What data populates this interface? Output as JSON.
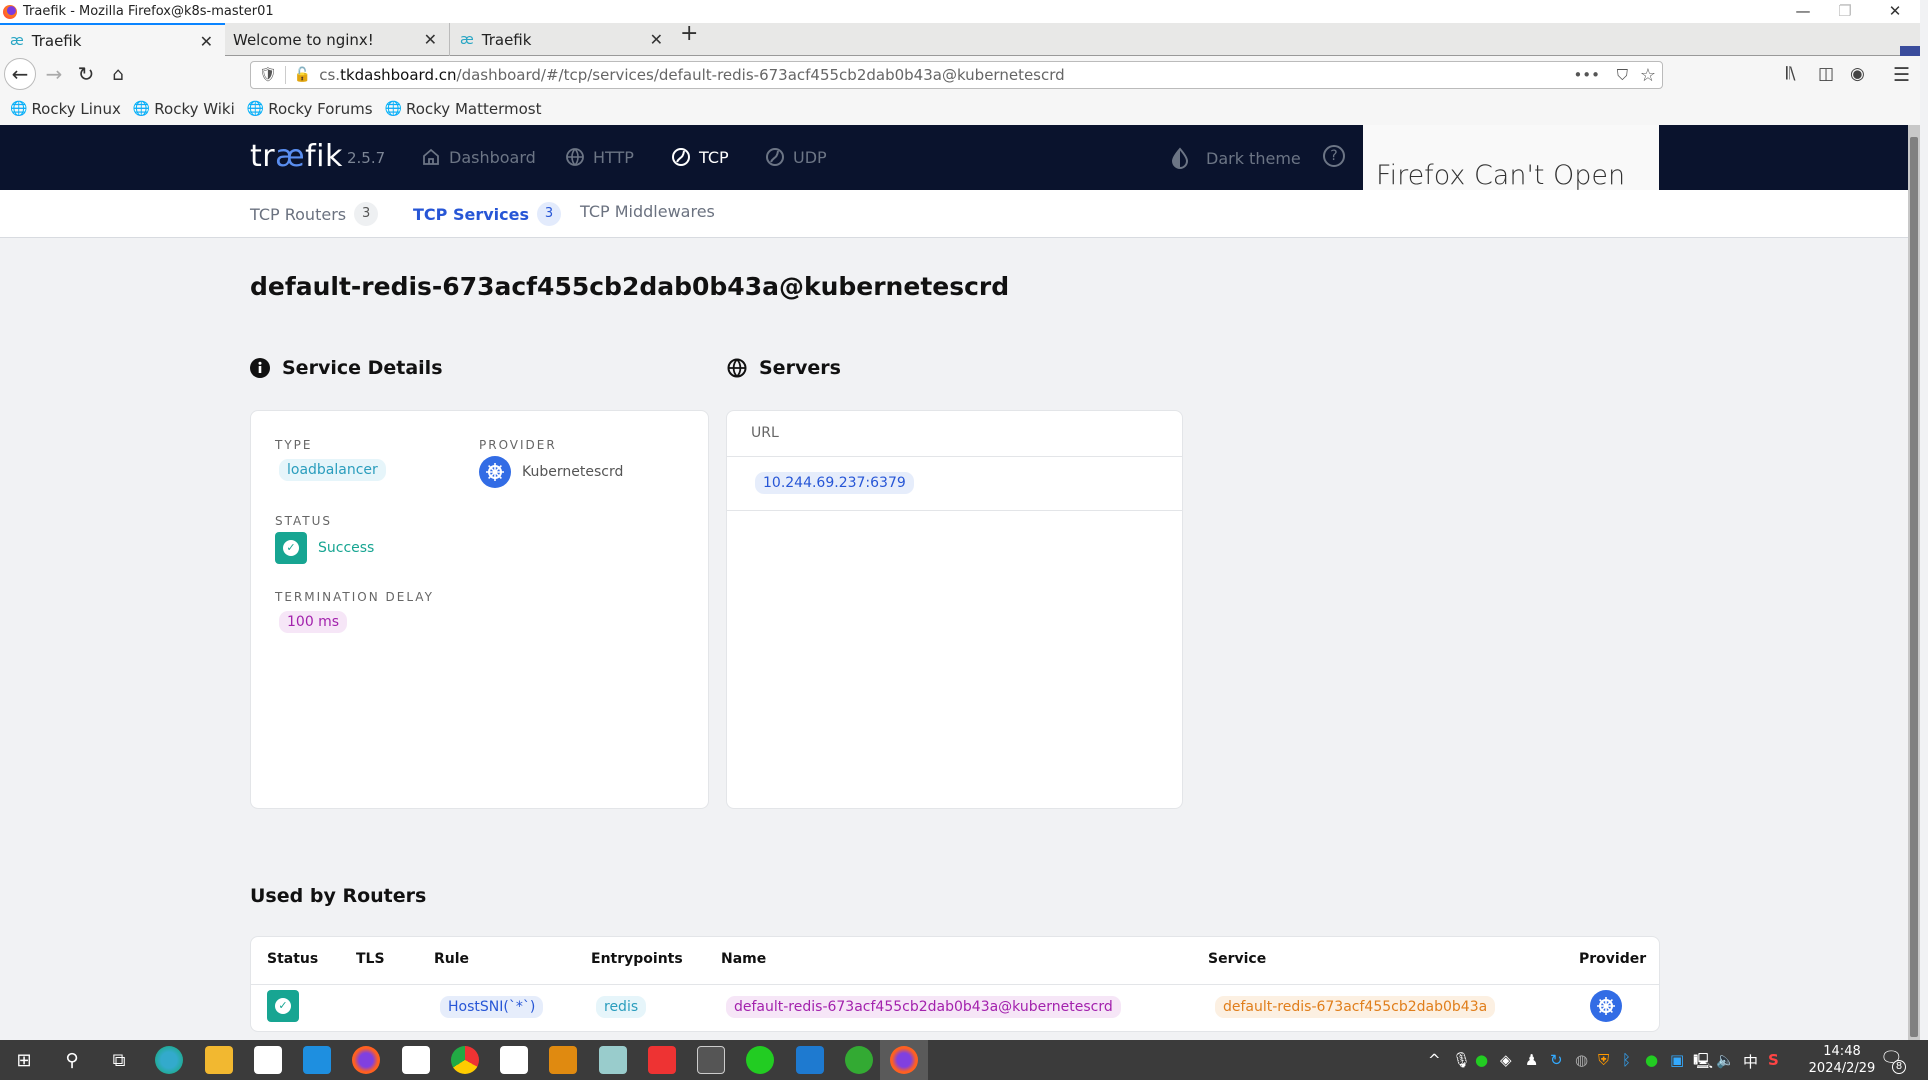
{
  "window": {
    "title": "Traefik - Mozilla Firefox@k8s-master01",
    "controls": {
      "minimize": "—",
      "maximize": "❐",
      "close": "✕"
    }
  },
  "tabs": [
    {
      "label": "Traefik",
      "icon": "ae-icon",
      "active": true
    },
    {
      "label": "Welcome to nginx!",
      "icon": "",
      "active": false
    },
    {
      "label": "Traefik",
      "icon": "ae-icon",
      "active": false
    }
  ],
  "navbar": {
    "url_prefix": "cs.",
    "url_host": "tkdashboard.cn",
    "url_path": "/dashboard/#/tcp/services/default-redis-673acf455cb2dab0b43a@kubernetescrd"
  },
  "bookmarks": [
    {
      "label": "Rocky Linux"
    },
    {
      "label": "Rocky Wiki"
    },
    {
      "label": "Rocky Forums"
    },
    {
      "label": "Rocky Mattermost"
    }
  ],
  "header": {
    "logo_pre": "tr",
    "logo_ae": "æ",
    "logo_post": "fik",
    "version": "2.5.7",
    "nav": [
      {
        "label": "Dashboard",
        "icon": "home-icon",
        "active": false
      },
      {
        "label": "HTTP",
        "icon": "globe-icon",
        "active": false
      },
      {
        "label": "TCP",
        "icon": "tcp-icon",
        "active": true
      },
      {
        "label": "UDP",
        "icon": "udp-icon",
        "active": false
      }
    ],
    "dark_theme_label": "Dark theme",
    "help": "?",
    "overlay_text": "Firefox Can't Open"
  },
  "subnav": [
    {
      "label": "TCP Routers",
      "count": "3",
      "active": false
    },
    {
      "label": "TCP Services",
      "count": "3",
      "active": true
    },
    {
      "label": "TCP Middlewares",
      "count": null,
      "active": false
    }
  ],
  "page": {
    "title": "default-redis-673acf455cb2dab0b43a@kubernetescrd"
  },
  "service_details": {
    "heading": "Service Details",
    "type_label": "TYPE",
    "type_value": "loadbalancer",
    "provider_label": "PROVIDER",
    "provider_value": "Kubernetescrd",
    "status_label": "STATUS",
    "status_value": "Success",
    "termination_delay_label": "TERMINATION DELAY",
    "termination_delay_value": "100 ms"
  },
  "servers": {
    "heading": "Servers",
    "column": "URL",
    "items": [
      "10.244.69.237:6379"
    ]
  },
  "used_by_routers": {
    "heading": "Used by Routers",
    "columns": [
      "Status",
      "TLS",
      "Rule",
      "Entrypoints",
      "Name",
      "Service",
      "Provider"
    ],
    "rows": [
      {
        "status": "success",
        "tls": "",
        "rule": "HostSNI(`*`)",
        "entrypoints": "redis",
        "name": "default-redis-673acf455cb2dab0b43a@kubernetescrd",
        "service": "default-redis-673acf455cb2dab0b43a",
        "provider": "kubernetescrd"
      }
    ]
  },
  "taskbar": {
    "time": "14:48",
    "date": "2024/2/29",
    "ime": "中",
    "notifications": "8"
  },
  "colors": {
    "header_bg": "#0a132d",
    "accent_blue": "#2756d6",
    "success": "#17a592",
    "k8s_blue": "#326ce5"
  }
}
